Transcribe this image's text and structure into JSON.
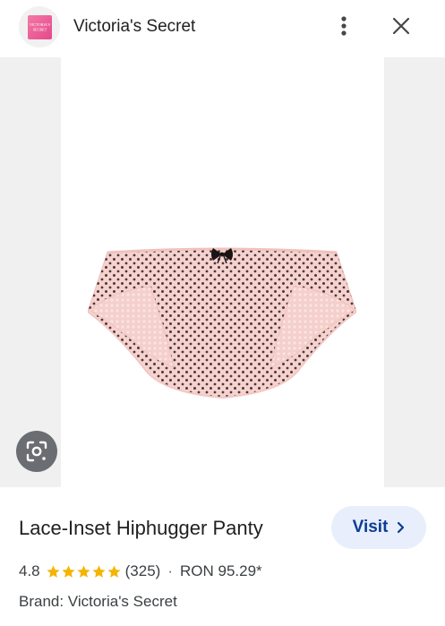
{
  "header": {
    "site_name": "Victoria's Secret",
    "logo_text": "VICTORIA'S SECRET",
    "more_icon": "more-vert-icon",
    "close_icon": "close-icon"
  },
  "image": {
    "lens_icon": "lens-search-icon"
  },
  "product": {
    "title": "Lace-Inset Hiphugger Panty",
    "rating": "4.8",
    "stars": 5,
    "review_count": "(325)",
    "separator": "·",
    "price": "RON 95.29*",
    "brand_label": "Brand: Victoria's Secret"
  },
  "actions": {
    "visit_label": "Visit"
  },
  "colors": {
    "accent": "#0b3d91",
    "visit_bg": "#e8eefc",
    "star": "#f5b400",
    "brand_pink": "#e5488a",
    "panty_pink": "#f6d2cf"
  }
}
